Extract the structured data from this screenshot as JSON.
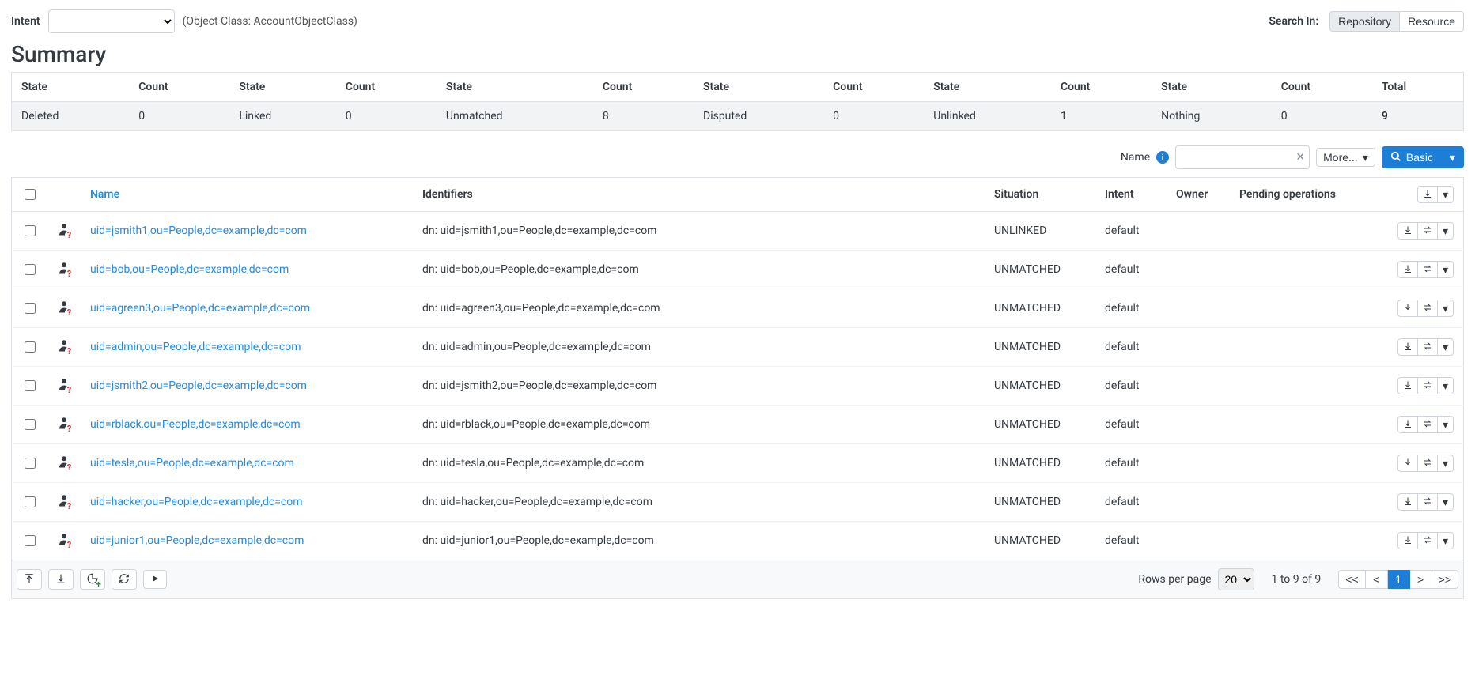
{
  "topbar": {
    "intent_label": "Intent",
    "object_class_text": "(Object Class: AccountObjectClass)",
    "search_in_label": "Search In:",
    "search_in_options": {
      "repository": "Repository",
      "resource": "Resource"
    }
  },
  "summary": {
    "title": "Summary",
    "headers": {
      "state": "State",
      "count": "Count",
      "total": "Total"
    },
    "cells": {
      "deleted_label": "Deleted",
      "deleted_count": "0",
      "linked_label": "Linked",
      "linked_count": "0",
      "unmatched_label": "Unmatched",
      "unmatched_count": "8",
      "disputed_label": "Disputed",
      "disputed_count": "0",
      "unlinked_label": "Unlinked",
      "unlinked_count": "1",
      "nothing_label": "Nothing",
      "nothing_count": "0",
      "total": "9"
    }
  },
  "filter": {
    "name_label": "Name",
    "more_label": "More...",
    "basic_label": "Basic"
  },
  "table": {
    "headers": {
      "name": "Name",
      "identifiers": "Identifiers",
      "situation": "Situation",
      "intent": "Intent",
      "owner": "Owner",
      "pending": "Pending operations"
    },
    "rows": [
      {
        "name": "uid=jsmith1,ou=People,dc=example,dc=com",
        "ident": "dn: uid=jsmith1,ou=People,dc=example,dc=com",
        "situation": "UNLINKED",
        "intent": "default"
      },
      {
        "name": "uid=bob,ou=People,dc=example,dc=com",
        "ident": "dn: uid=bob,ou=People,dc=example,dc=com",
        "situation": "UNMATCHED",
        "intent": "default"
      },
      {
        "name": "uid=agreen3,ou=People,dc=example,dc=com",
        "ident": "dn: uid=agreen3,ou=People,dc=example,dc=com",
        "situation": "UNMATCHED",
        "intent": "default"
      },
      {
        "name": "uid=admin,ou=People,dc=example,dc=com",
        "ident": "dn: uid=admin,ou=People,dc=example,dc=com",
        "situation": "UNMATCHED",
        "intent": "default"
      },
      {
        "name": "uid=jsmith2,ou=People,dc=example,dc=com",
        "ident": "dn: uid=jsmith2,ou=People,dc=example,dc=com",
        "situation": "UNMATCHED",
        "intent": "default"
      },
      {
        "name": "uid=rblack,ou=People,dc=example,dc=com",
        "ident": "dn: uid=rblack,ou=People,dc=example,dc=com",
        "situation": "UNMATCHED",
        "intent": "default"
      },
      {
        "name": "uid=tesla,ou=People,dc=example,dc=com",
        "ident": "dn: uid=tesla,ou=People,dc=example,dc=com",
        "situation": "UNMATCHED",
        "intent": "default"
      },
      {
        "name": "uid=hacker,ou=People,dc=example,dc=com",
        "ident": "dn: uid=hacker,ou=People,dc=example,dc=com",
        "situation": "UNMATCHED",
        "intent": "default"
      },
      {
        "name": "uid=junior1,ou=People,dc=example,dc=com",
        "ident": "dn: uid=junior1,ou=People,dc=example,dc=com",
        "situation": "UNMATCHED",
        "intent": "default"
      }
    ]
  },
  "footer": {
    "rows_per_page_label": "Rows per page",
    "rows_per_page_value": "20",
    "range_text": "1 to 9 of 9",
    "pager": {
      "first": "<<",
      "prev": "<",
      "current": "1",
      "next": ">",
      "last": ">>"
    }
  }
}
